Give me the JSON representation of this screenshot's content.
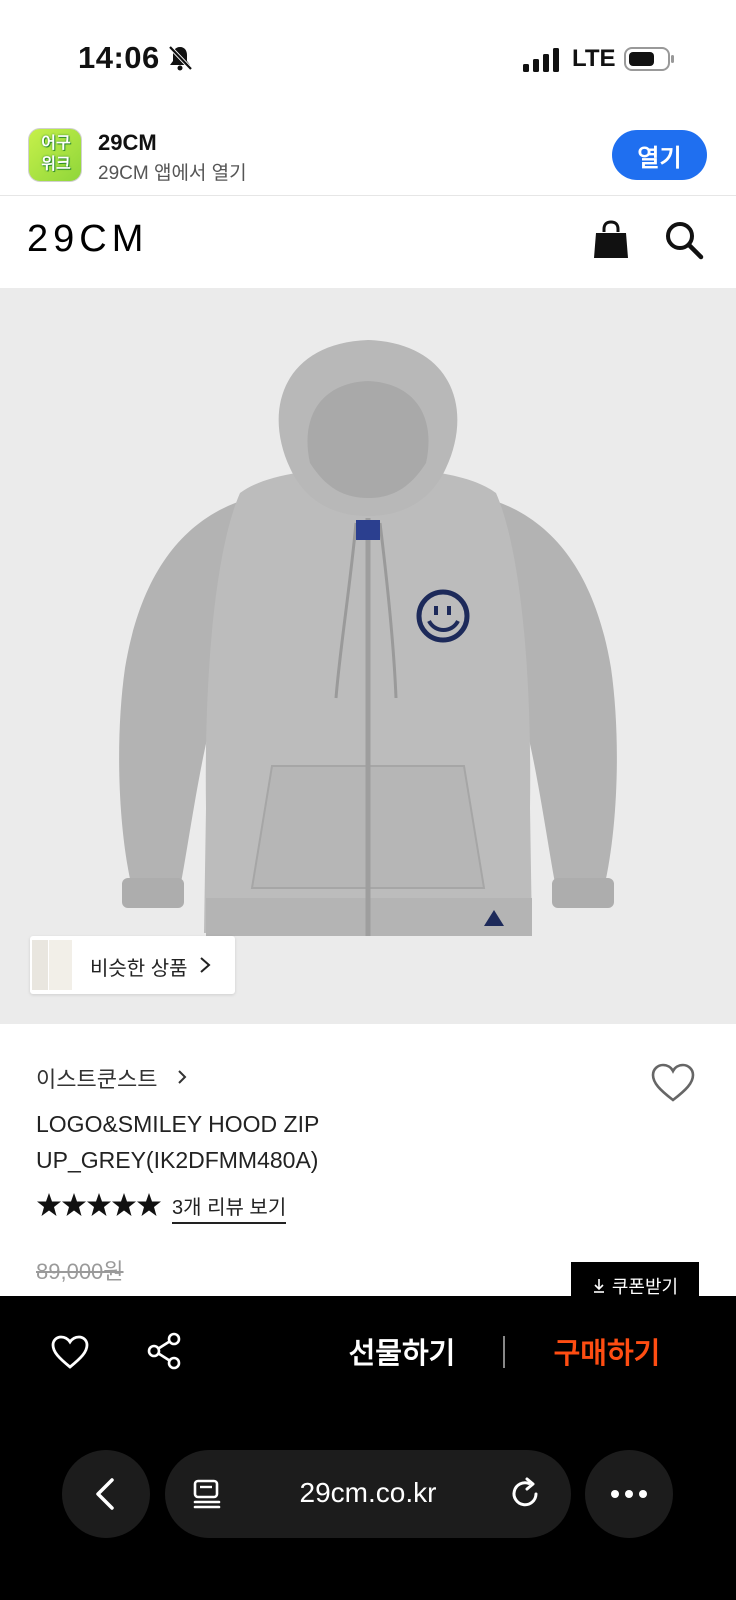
{
  "status_bar": {
    "time": "14:06",
    "network": "LTE",
    "icons": [
      "bell-slash-icon",
      "signal-icon",
      "battery-icon"
    ]
  },
  "app_banner": {
    "icon_text": "어구위크",
    "app_name": "29CM",
    "subtitle": "29CM 앱에서 열기",
    "open_label": "열기",
    "open_color": "#1F6FF0"
  },
  "header": {
    "logo": "29CM",
    "icons": [
      "shopping-bag-icon",
      "search-icon"
    ]
  },
  "product_image": {
    "background": "#EBEBEB",
    "similar_label": "비슷한 상품"
  },
  "product": {
    "brand": "이스트쿤스트",
    "title": "LOGO&SMILEY HOOD ZIP UP_GREY(IK2DFMM480A)",
    "rating_stars": 5,
    "review_link": "3개 리뷰 보기",
    "original_price": "89,000원",
    "coupon_label": "쿠폰받기"
  },
  "action_bar": {
    "gift_label": "선물하기",
    "buy_label": "구매하기",
    "buy_color": "#FF4D12",
    "icons": [
      "heart-icon",
      "share-icon"
    ]
  },
  "browser": {
    "url": "29cm.co.kr",
    "icons": [
      "back-chevron-icon",
      "reader-icon",
      "reload-icon",
      "more-icon"
    ]
  }
}
